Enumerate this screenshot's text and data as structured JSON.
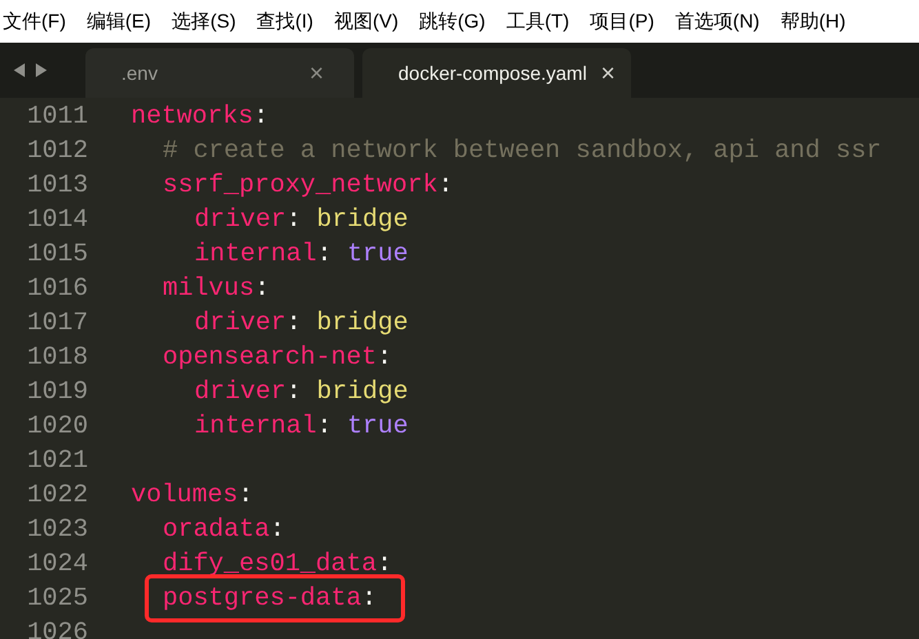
{
  "menu": [
    {
      "label": "文件(F)"
    },
    {
      "label": "编辑(E)"
    },
    {
      "label": "选择(S)"
    },
    {
      "label": "查找(I)"
    },
    {
      "label": "视图(V)"
    },
    {
      "label": "跳转(G)"
    },
    {
      "label": "工具(T)"
    },
    {
      "label": "项目(P)"
    },
    {
      "label": "首选项(N)"
    },
    {
      "label": "帮助(H)"
    }
  ],
  "tabs": [
    {
      "label": ".env",
      "selected": false,
      "close": "×"
    },
    {
      "label": "docker-compose.yaml",
      "selected": true,
      "close": "×"
    }
  ],
  "lines": [
    {
      "number": "1011",
      "highlighted": false,
      "tokens": [
        {
          "kind": "key",
          "text": "networks"
        },
        {
          "kind": "punct",
          "text": ":"
        }
      ],
      "children": [
        {
          "number": "1012",
          "highlighted": false,
          "tokens": [
            {
              "kind": "comment",
              "text": "# create a network between sandbox, api and ssr"
            }
          ]
        },
        {
          "number": "1013",
          "highlighted": false,
          "tokens": [
            {
              "kind": "key",
              "text": "ssrf_proxy_network"
            },
            {
              "kind": "punct",
              "text": ":"
            }
          ],
          "children": [
            {
              "number": "1014",
              "highlighted": false,
              "tokens": [
                {
                  "kind": "key",
                  "text": "driver"
                },
                {
                  "kind": "punct",
                  "text": ":"
                },
                {
                  "kind": "string",
                  "text": "bridge"
                }
              ]
            },
            {
              "number": "1015",
              "highlighted": false,
              "tokens": [
                {
                  "kind": "key",
                  "text": "internal"
                },
                {
                  "kind": "punct",
                  "text": ":"
                },
                {
                  "kind": "bool",
                  "text": "true"
                }
              ]
            }
          ]
        },
        {
          "number": "1016",
          "highlighted": false,
          "tokens": [
            {
              "kind": "key",
              "text": "milvus"
            },
            {
              "kind": "punct",
              "text": ":"
            }
          ],
          "children": [
            {
              "number": "1017",
              "highlighted": false,
              "tokens": [
                {
                  "kind": "key",
                  "text": "driver"
                },
                {
                  "kind": "punct",
                  "text": ":"
                },
                {
                  "kind": "string",
                  "text": "bridge"
                }
              ]
            }
          ]
        },
        {
          "number": "1018",
          "highlighted": false,
          "tokens": [
            {
              "kind": "key",
              "text": "opensearch-net"
            },
            {
              "kind": "punct",
              "text": ":"
            }
          ],
          "children": [
            {
              "number": "1019",
              "highlighted": false,
              "tokens": [
                {
                  "kind": "key",
                  "text": "driver"
                },
                {
                  "kind": "punct",
                  "text": ":"
                },
                {
                  "kind": "string",
                  "text": "bridge"
                }
              ]
            },
            {
              "number": "1020",
              "highlighted": false,
              "tokens": [
                {
                  "kind": "key",
                  "text": "internal"
                },
                {
                  "kind": "punct",
                  "text": ":"
                },
                {
                  "kind": "bool",
                  "text": "true"
                }
              ]
            }
          ]
        }
      ]
    },
    {
      "number": "1021"
    },
    {
      "number": "1022",
      "highlighted": false,
      "tokens": [
        {
          "kind": "key",
          "text": "volumes"
        },
        {
          "kind": "punct",
          "text": ":"
        }
      ],
      "children": [
        {
          "number": "1023",
          "highlighted": false,
          "tokens": [
            {
              "kind": "key",
              "text": "oradata"
            },
            {
              "kind": "punct",
              "text": ":"
            }
          ]
        },
        {
          "number": "1024",
          "highlighted": false,
          "tokens": [
            {
              "kind": "key",
              "text": "dify_es01_data"
            },
            {
              "kind": "punct",
              "text": ":"
            }
          ]
        },
        {
          "number": "1025",
          "highlighted": true,
          "tokens": [
            {
              "kind": "key",
              "text": "postgres-data"
            },
            {
              "kind": "punct",
              "text": ":"
            }
          ]
        }
      ]
    },
    {
      "number": "1026"
    }
  ]
}
